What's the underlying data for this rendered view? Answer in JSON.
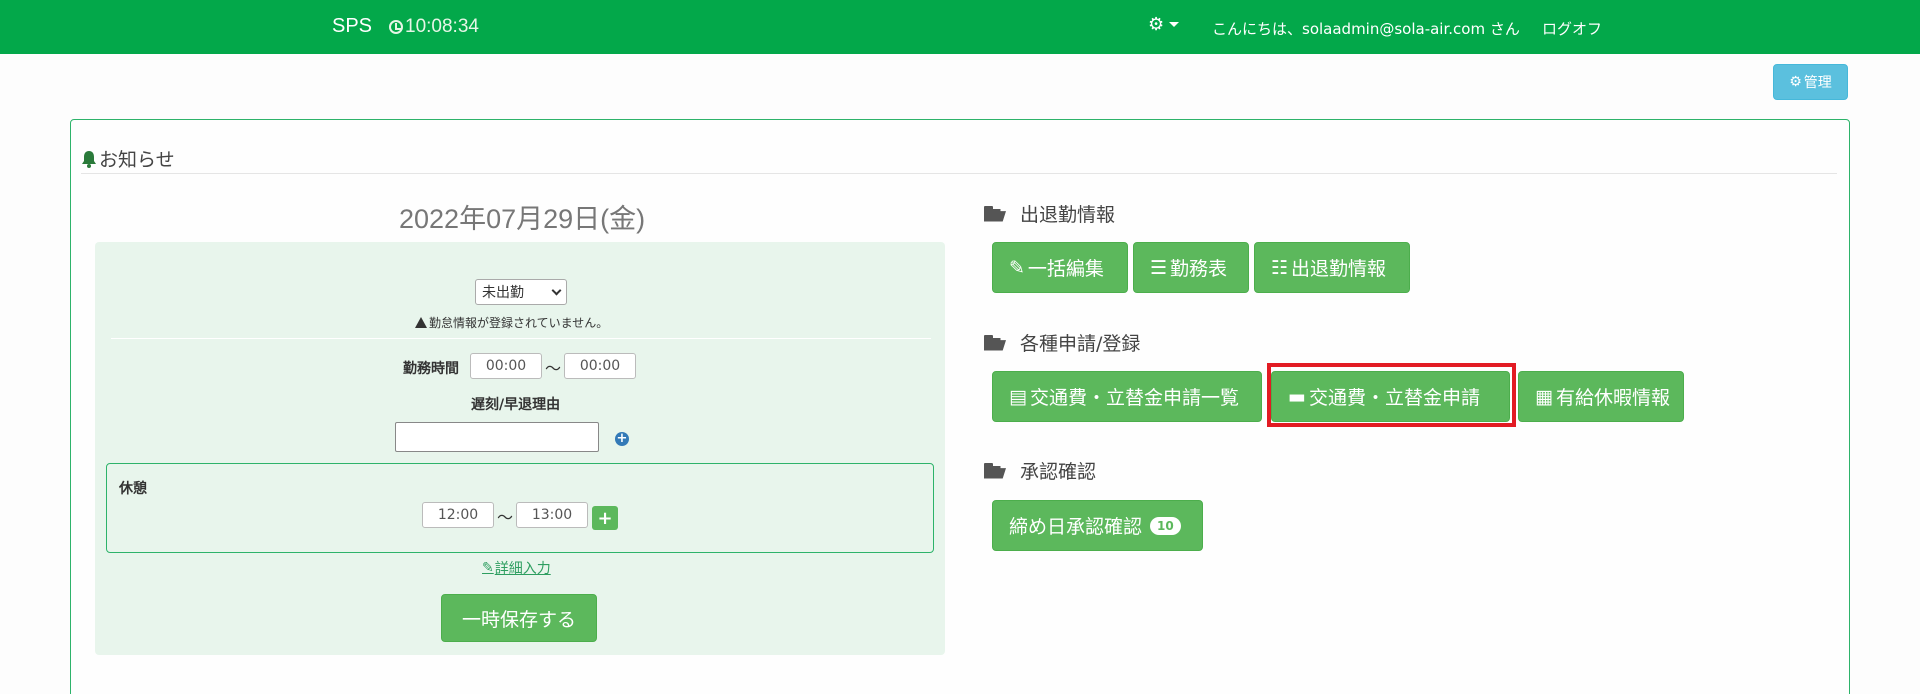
{
  "navbar": {
    "brand": "SPS",
    "clock_time": "10:08:34",
    "greeting": "こんにちは、solaadmin@sola-air.com さん",
    "logoff": "ログオフ"
  },
  "admin_button": "管理",
  "notice": {
    "heading": "お知らせ"
  },
  "attendance": {
    "date": "2022年07月29日(金)",
    "status_selected": "未出勤",
    "warning": "勤怠情報が登録されていません。",
    "work_time_label": "勤務時間",
    "work_start": "00:00",
    "work_end": "00:00",
    "tilde": "〜",
    "late_reason_label": "遅刻/早退理由",
    "late_reason_value": "",
    "break_label": "休憩",
    "break_start": "12:00",
    "break_end": "13:00",
    "detail_link": "詳細入力",
    "save_button": "一時保存する"
  },
  "sections": [
    {
      "title": "出退勤情報",
      "buttons": [
        "一括編集",
        "勤務表",
        "出退勤情報"
      ]
    },
    {
      "title": "各種申請/登録",
      "buttons": [
        "交通費・立替金申請一覧",
        "交通費・立替金申請",
        "有給休暇情報"
      ]
    },
    {
      "title": "承認確認",
      "buttons": [
        "締め日承認確認"
      ],
      "badge": "10"
    }
  ],
  "colors": {
    "navbar": "#03a84a",
    "button_green": "#5cb85c",
    "admin_blue": "#5bc0de",
    "highlight_red": "#e21b23"
  }
}
